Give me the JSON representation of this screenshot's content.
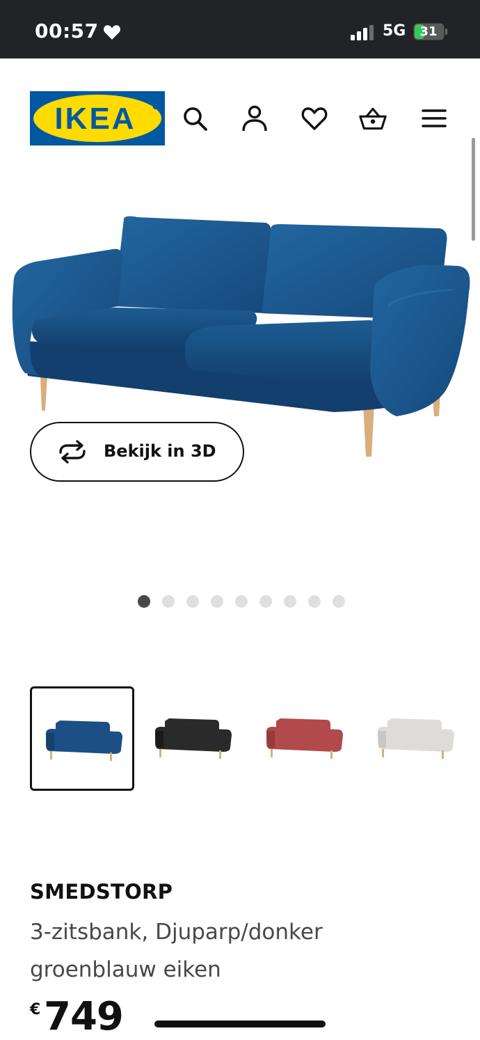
{
  "status_bar": {
    "time": "00:57",
    "network": "5G",
    "battery": "31"
  },
  "header": {
    "logo_text": "IKEA",
    "brand_colors": {
      "blue": "#0058a3",
      "yellow": "#ffdb00"
    },
    "icons": [
      "search-icon",
      "account-icon",
      "favorites-icon",
      "cart-icon",
      "menu-icon"
    ]
  },
  "gallery": {
    "view_3d_label": "Bekijk in 3D",
    "dot_count": 9,
    "active_dot": 1,
    "thumbnails": [
      {
        "color_name": "blue",
        "color": "#1b4f86",
        "selected": true
      },
      {
        "color_name": "black",
        "color": "#2a2a2a",
        "selected": false
      },
      {
        "color_name": "red",
        "color": "#b2494a",
        "selected": false
      },
      {
        "color_name": "light grey",
        "color": "#dedcd8",
        "selected": false
      }
    ]
  },
  "product": {
    "name": "SMEDSTORP",
    "description": "3-zitsbank, Djuparp/donker groenblauw eiken",
    "currency": "€",
    "price": "749"
  }
}
